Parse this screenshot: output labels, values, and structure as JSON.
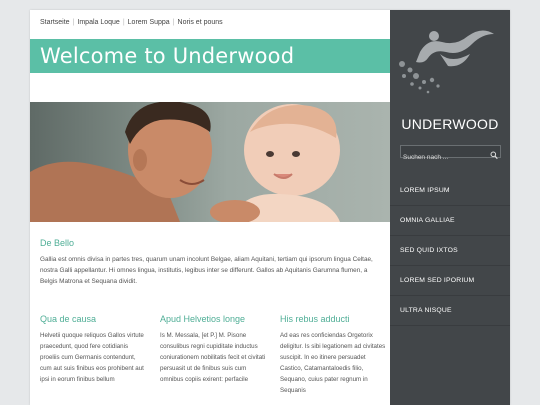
{
  "nav": {
    "items": [
      "Startseite",
      "Impala Loque",
      "Lorem Suppa",
      "Noris et pouns"
    ]
  },
  "banner": {
    "title": "Welcome to Underwood",
    "color": "#5bbfa6"
  },
  "intro": {
    "heading": "De Bello",
    "text": "Gallia est omnis divisa in partes tres, quarum unam incolunt Belgae, aliam Aquitani, tertiam qui ipsorum lingua Celtae, nostra Galli appellantur. Hi omnes lingua, institutis, legibus inter se differunt. Gallos ab Aquitanis Garumna flumen, a Belgis Matrona et Sequana dividit."
  },
  "columns": [
    {
      "heading": "Qua de causa",
      "text": "Helvetii quoque reliquos Gallos virtute praecedunt, quod fere cotidianis proeliis cum Germanis contendunt, cum aut suis finibus eos prohibent aut ipsi in eorum finibus bellum"
    },
    {
      "heading": "Apud Helvetios longe",
      "text": "Is M. Messala, [et P.] M. Pisone consulibus regni cupiditate inductus coniurationem nobilitatis fecit et civitati persuasit ut de finibus suis cum omnibus copiis exirent: perfacile"
    },
    {
      "heading": "His rebus adducti",
      "text": "Ad eas res conficiendas Orgetorix deligitur. Is sibi legationem ad civitates suscipit. In eo itinere persuadet Castico, Catamantaloedis filio, Sequano, cuius pater regnum in Sequanis"
    }
  ],
  "sidebar": {
    "logo_text": "UNDERWOOD",
    "search_placeholder": "Suchen nach ...",
    "menu": [
      "Lorem ipsum",
      "Omnia Galliae",
      "Sed quid ixtos",
      "Lorem sed iporium",
      "Ultra nisque"
    ],
    "bg_color": "#424649"
  },
  "accent_color": "#4fae96",
  "icons": {
    "search": "search-icon",
    "logo": "swimmer-logo-icon"
  }
}
